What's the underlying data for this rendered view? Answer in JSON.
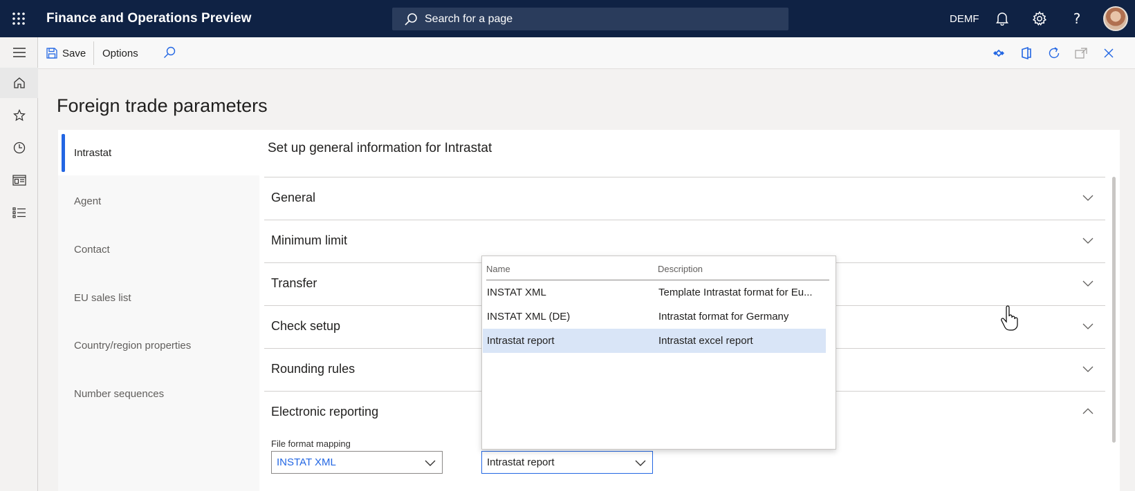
{
  "app": {
    "title": "Finance and Operations Preview",
    "company": "DEMF"
  },
  "search": {
    "placeholder": "Search for a page"
  },
  "actionbar": {
    "save_label": "Save",
    "options_label": "Options"
  },
  "page": {
    "title": "Foreign trade parameters"
  },
  "tabs": [
    {
      "label": "Intrastat",
      "active": true
    },
    {
      "label": "Agent"
    },
    {
      "label": "Contact"
    },
    {
      "label": "EU sales list"
    },
    {
      "label": "Country/region properties"
    },
    {
      "label": "Number sequences"
    }
  ],
  "content": {
    "title": "Set up general information for Intrastat",
    "fasttabs": [
      {
        "label": "General",
        "expanded": false
      },
      {
        "label": "Minimum limit",
        "expanded": false
      },
      {
        "label": "Transfer",
        "expanded": false
      },
      {
        "label": "Check setup",
        "expanded": false
      },
      {
        "label": "Rounding rules",
        "expanded": false
      },
      {
        "label": "Electronic reporting",
        "expanded": true
      }
    ],
    "file_format_mapping": {
      "label": "File format mapping",
      "value": "INSTAT XML"
    },
    "report_format": {
      "value": "Intrastat report"
    }
  },
  "dropdown": {
    "headers": [
      "Name",
      "Description"
    ],
    "rows": [
      {
        "name": "INSTAT XML",
        "description": "Template Intrastat format for Eu..."
      },
      {
        "name": "INSTAT XML (DE)",
        "description": "Intrastat format for Germany"
      },
      {
        "name": "Intrastat report",
        "description": "Intrastat excel report",
        "selected": true
      }
    ]
  },
  "colors": {
    "topbar": "#0f2244",
    "accent": "#2266e3",
    "link": "#2266e3",
    "selected_row": "#d9e5f7"
  }
}
